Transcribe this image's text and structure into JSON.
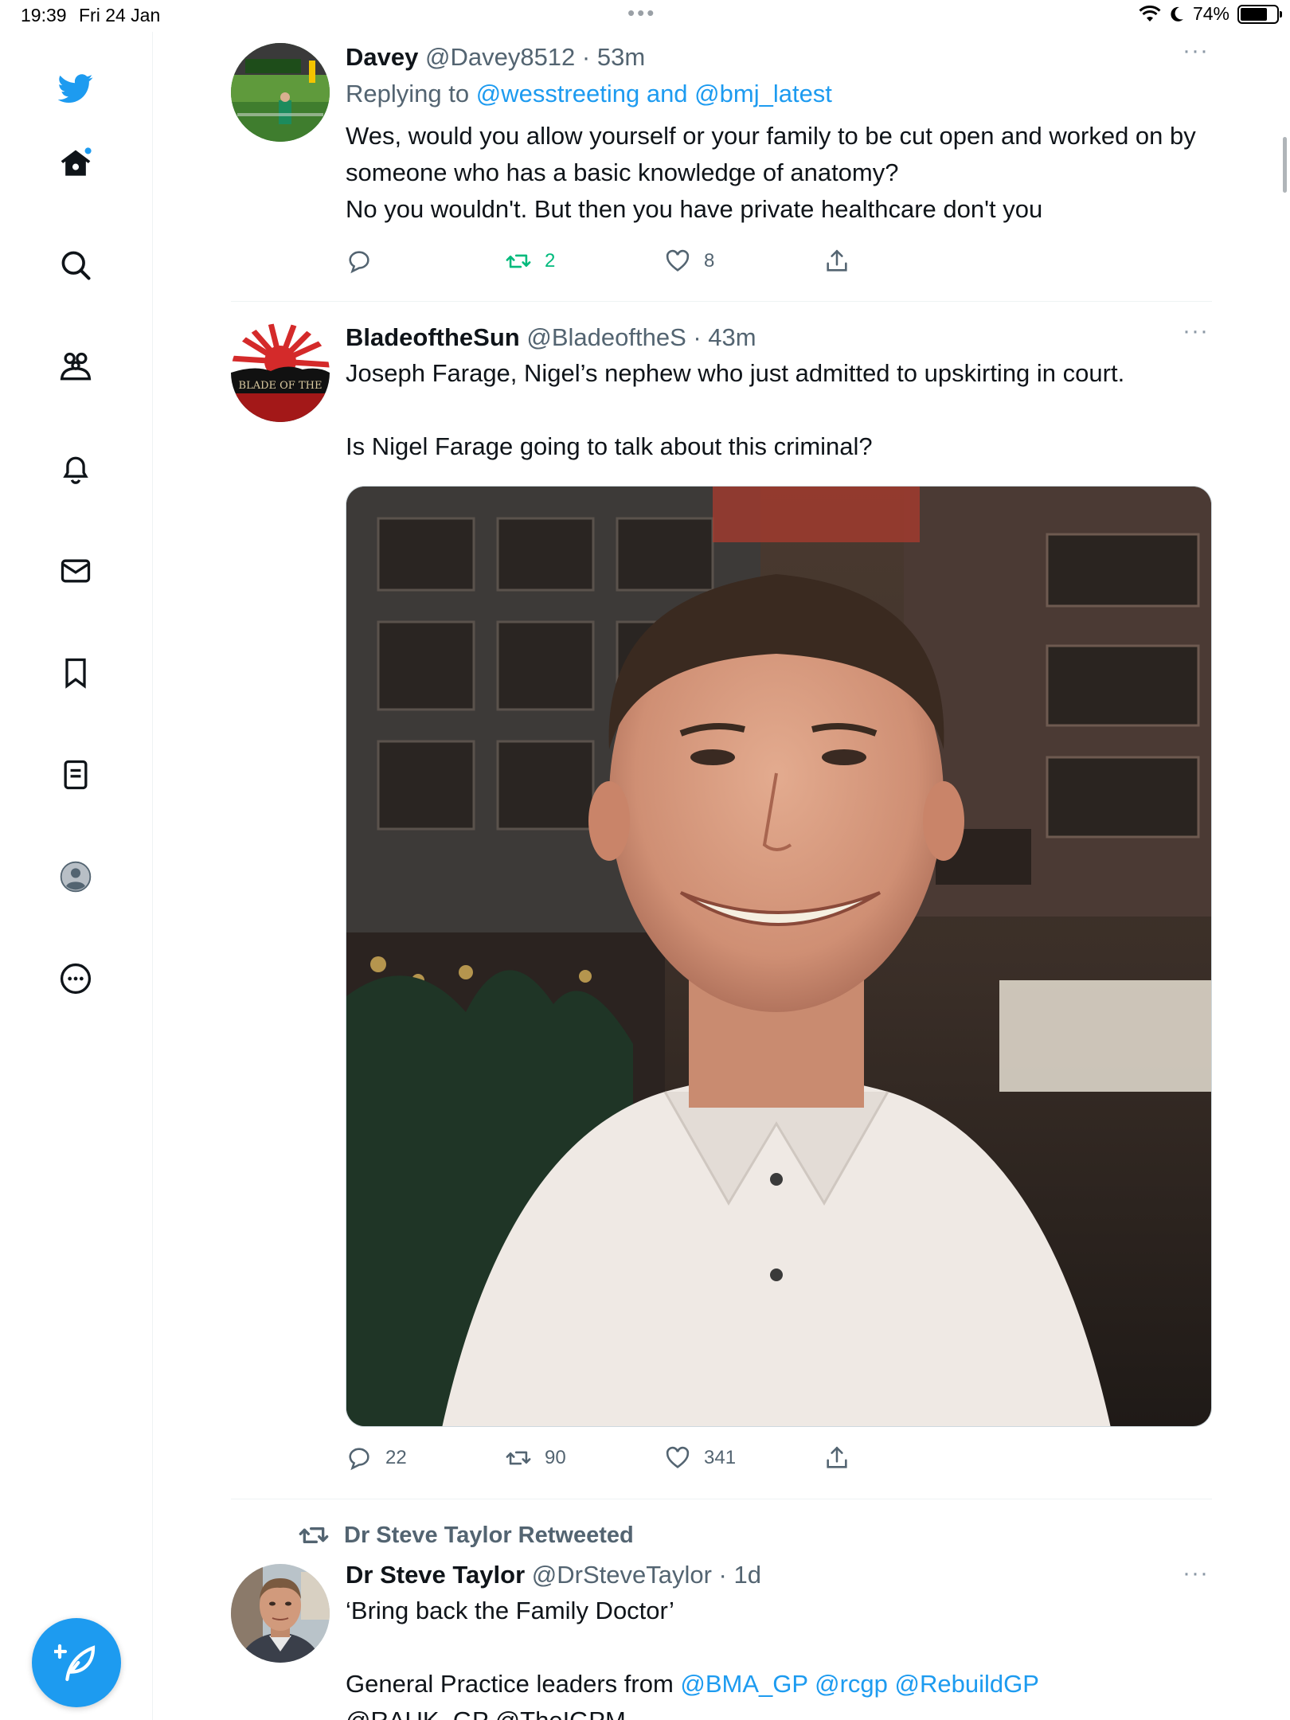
{
  "status_bar": {
    "time": "19:39",
    "date": "Fri 24 Jan",
    "battery": "74%",
    "battery_level": 0.74
  },
  "sidebar": {
    "items": [
      {
        "name": "twitter-logo",
        "icon": "bird-icon"
      },
      {
        "name": "home",
        "icon": "home-icon"
      },
      {
        "name": "explore",
        "icon": "search-icon"
      },
      {
        "name": "communities",
        "icon": "communities-icon"
      },
      {
        "name": "notifications",
        "icon": "bell-icon"
      },
      {
        "name": "messages",
        "icon": "mail-icon"
      },
      {
        "name": "bookmarks",
        "icon": "bookmark-icon"
      },
      {
        "name": "lists",
        "icon": "list-icon"
      },
      {
        "name": "profile",
        "icon": "avatar-icon"
      },
      {
        "name": "more",
        "icon": "more-circle-icon"
      }
    ],
    "compose_icon": "compose-icon"
  },
  "tweets": [
    {
      "name": "Davey",
      "handle": "@Davey8512",
      "time": "· 53m",
      "replying_prefix": "Replying to",
      "replying_to": "@wesstreeting and @bmj_latest",
      "text": "Wes, would you allow yourself or your family to be cut open and worked on by someone who has a basic knowledge of anatomy?\nNo you wouldn't. But then you have private healthcare don't you",
      "replies": "",
      "retweets": "2",
      "likes": "8"
    },
    {
      "name": "BladeoftheSun",
      "handle": "@BladeoftheS",
      "time": "· 43m",
      "text_line1": "Joseph Farage, Nigel’s nephew who just admitted to upskirting in court.",
      "text_line2": "Is Nigel Farage going to talk about this criminal?",
      "avatar_text": "BLADE OF THE",
      "replies": "22",
      "retweets": "90",
      "likes": "341"
    },
    {
      "retweeted_by": "Dr Steve Taylor Retweeted",
      "name": "Dr Steve Taylor",
      "handle": "@DrSteveTaylor",
      "time": "· 1d",
      "text_line1": "‘Bring back the Family Doctor’",
      "text_prefix": "General Practice leaders from ",
      "mentions": "@BMA_GP @rcgp @RebuildGP",
      "text_cutoff": "@RAUK_GP @TheIGPM"
    }
  ],
  "colors": {
    "accent": "#1d9bf0",
    "retweet_green": "#00ba7c",
    "secondary_text": "#536471"
  }
}
